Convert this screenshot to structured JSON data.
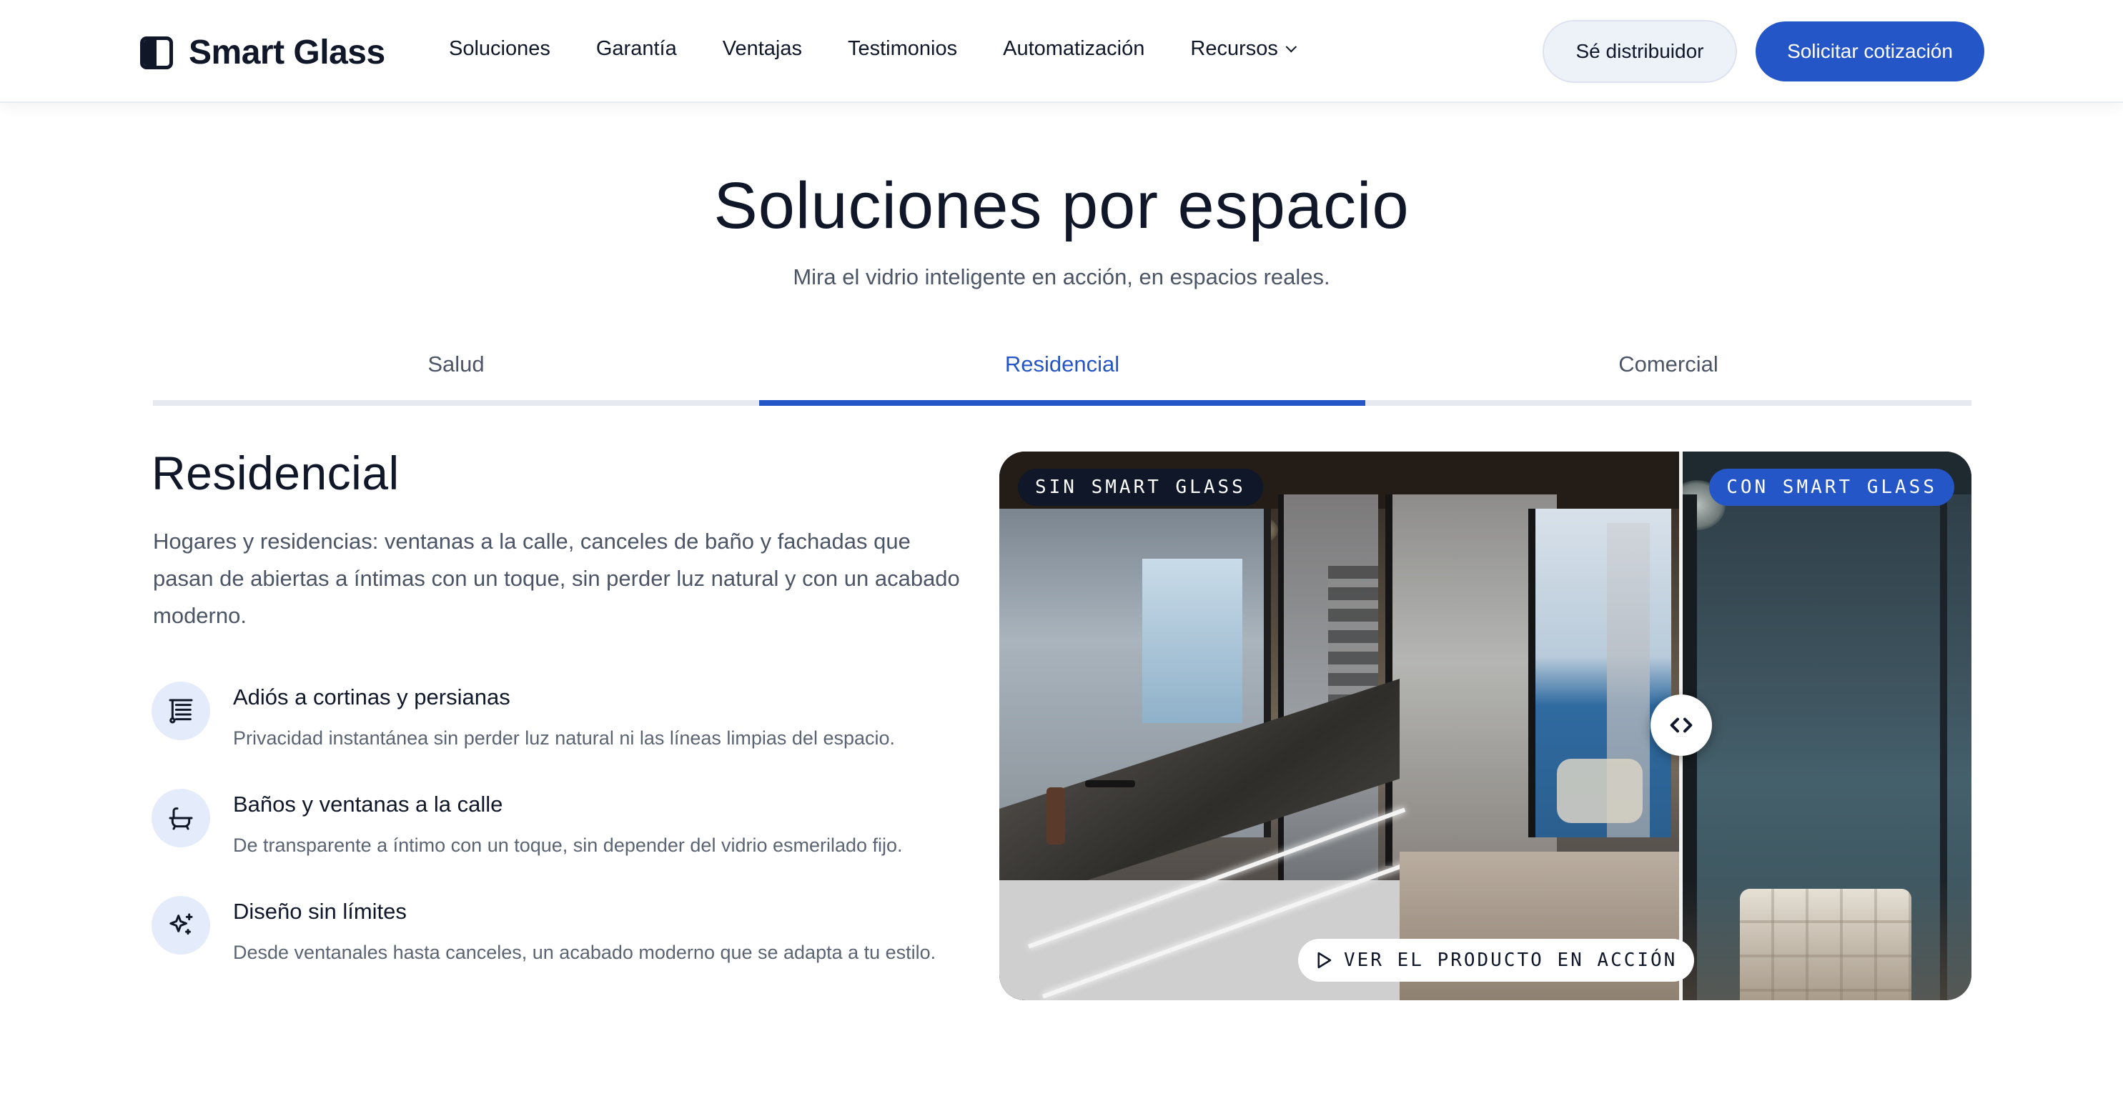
{
  "header": {
    "logo_text": "Smart Glass",
    "nav": [
      {
        "label": "Soluciones"
      },
      {
        "label": "Garantía"
      },
      {
        "label": "Ventajas"
      },
      {
        "label": "Testimonios"
      },
      {
        "label": "Automatización"
      },
      {
        "label": "Recursos",
        "has_dropdown": true
      }
    ],
    "distributor_label": "Sé distribuidor",
    "quote_label": "Solicitar cotización"
  },
  "section": {
    "title": "Soluciones por espacio",
    "subtitle": "Mira el vidrio inteligente en acción, en espacios reales."
  },
  "tabs": [
    {
      "label": "Salud",
      "active": false
    },
    {
      "label": "Residencial",
      "active": true
    },
    {
      "label": "Comercial",
      "active": false
    }
  ],
  "content": {
    "title": "Residencial",
    "description": "Hogares y residencias: ventanas a la calle, canceles de baño y fachadas que pasan de abiertas a íntimas con un toque, sin perder luz natural y con un acabado moderno.",
    "features": [
      {
        "icon": "blinds-icon",
        "title": "Adiós a cortinas y persianas",
        "desc": "Privacidad instantánea sin perder luz natural ni las líneas limpias del espacio."
      },
      {
        "icon": "bath-icon",
        "title": "Baños y ventanas a la calle",
        "desc": "De transparente a íntimo con un toque, sin depender del vidrio esmerilado fijo."
      },
      {
        "icon": "sparkles-icon",
        "title": "Diseño sin límites",
        "desc": "Desde ventanales hasta canceles, un acabado moderno que se adapta a tu estilo."
      }
    ]
  },
  "comparison": {
    "before_label": "SIN SMART GLASS",
    "after_label": "CON SMART GLASS",
    "watch_label": "VER EL PRODUCTO EN ACCIÓN"
  },
  "colors": {
    "accent": "#2456c7",
    "dark": "#0f1729",
    "muted_text": "#4b5565",
    "icon_bg": "#e4ebfb"
  }
}
